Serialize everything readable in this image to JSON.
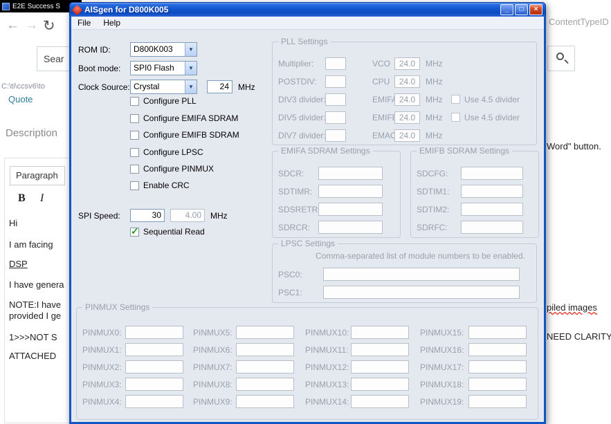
{
  "icons": {
    "dropdown_arrow": "▼",
    "back_arrow": "←",
    "forward_arrow": "→",
    "refresh": "↻",
    "check": "✓",
    "minimize": "_",
    "maximize": "□",
    "close": "×"
  },
  "browser": {
    "taskbar_title": "E2E Success S",
    "content_type_text": "ContentTypeID",
    "search_value": "Sear",
    "path_text": "C:\\ti\\ccsv6\\to",
    "quote_link": "Quote",
    "description_heading": "Description",
    "editor": {
      "paragraph_button": "Paragraph",
      "bold": "B",
      "italic": "I"
    },
    "post_lines": [
      "Hi",
      "I am facing",
      "DSP",
      "I have genera",
      "NOTE:I have",
      "provided I ge",
      "1>>>NOT S",
      "ATTACHED"
    ],
    "right_fragments": {
      "word": "Word\" button.",
      "compiled": "piled images",
      "clarity": "NEED CLARITY)"
    }
  },
  "dialog": {
    "title": "AISgen for D800K005",
    "menu": [
      "File",
      "Help"
    ],
    "general": {
      "rom_id_label": "ROM ID:",
      "rom_id_value": "D800K003",
      "boot_mode_label": "Boot mode:",
      "boot_mode_value": "SPI0 Flash",
      "clock_source_label": "Clock Source:",
      "clock_source_value": "Crystal",
      "clock_mhz_value": "24",
      "mhz_unit": "MHz",
      "checkboxes": [
        {
          "label": "Configure PLL",
          "checked": false
        },
        {
          "label": "Configure EMIFA SDRAM",
          "checked": false
        },
        {
          "label": "Configure EMIFB SDRAM",
          "checked": false
        },
        {
          "label": "Configure LPSC",
          "checked": false
        },
        {
          "label": "Configure PINMUX",
          "checked": false
        },
        {
          "label": "Enable CRC",
          "checked": false
        }
      ],
      "spi_speed_label": "SPI Speed:",
      "spi_speed_value": "30",
      "spi_actual_value": "4.00",
      "sequential_read": {
        "label": "Sequential Read",
        "checked": true
      }
    },
    "pll": {
      "title": "PLL Settings",
      "mhz_unit": "MHz",
      "divider_label": "Use 4.5 divider",
      "rows": [
        {
          "label": "Multiplier:",
          "value": "",
          "out_label": "VCO",
          "out_value": "24.0",
          "has_divider": false
        },
        {
          "label": "POSTDIV:",
          "value": "",
          "out_label": "CPU",
          "out_value": "24.0",
          "has_divider": false
        },
        {
          "label": "DIV3 divider:",
          "value": "",
          "out_label": "EMIFA",
          "out_value": "24.0",
          "has_divider": true
        },
        {
          "label": "DIV5 divider:",
          "value": "",
          "out_label": "EMIFB",
          "out_value": "24.0",
          "has_divider": true
        },
        {
          "label": "DIV7 divider:",
          "value": "",
          "out_label": "EMAC",
          "out_value": "24.0",
          "has_divider": false
        }
      ]
    },
    "emifa": {
      "title": "EMIFA SDRAM Settings",
      "fields": [
        {
          "label": "SDCR:",
          "value": ""
        },
        {
          "label": "SDTIMR:",
          "value": ""
        },
        {
          "label": "SDSRETR:",
          "value": ""
        },
        {
          "label": "SDRCR:",
          "value": ""
        }
      ]
    },
    "emifb": {
      "title": "EMIFB SDRAM Settings",
      "fields": [
        {
          "label": "SDCFG:",
          "value": ""
        },
        {
          "label": "SDTIM1:",
          "value": ""
        },
        {
          "label": "SDTIM2:",
          "value": ""
        },
        {
          "label": "SDRFC:",
          "value": ""
        }
      ]
    },
    "lpsc": {
      "title": "LPSC Settings",
      "hint": "Comma-separated list of module numbers to be enabled.",
      "fields": [
        {
          "label": "PSC0:",
          "value": ""
        },
        {
          "label": "PSC1:",
          "value": ""
        }
      ]
    },
    "pinmux": {
      "title": "PINMUX Settings",
      "fields": [
        "PINMUX0:",
        "PINMUX1:",
        "PINMUX2:",
        "PINMUX3:",
        "PINMUX4:",
        "PINMUX5:",
        "PINMUX6:",
        "PINMUX7:",
        "PINMUX8:",
        "PINMUX9:",
        "PINMUX10:",
        "PINMUX11:",
        "PINMUX12:",
        "PINMUX13:",
        "PINMUX14:",
        "PINMUX15:",
        "PINMUX16:",
        "PINMUX17:",
        "PINMUX18:",
        "PINMUX19:"
      ]
    }
  }
}
